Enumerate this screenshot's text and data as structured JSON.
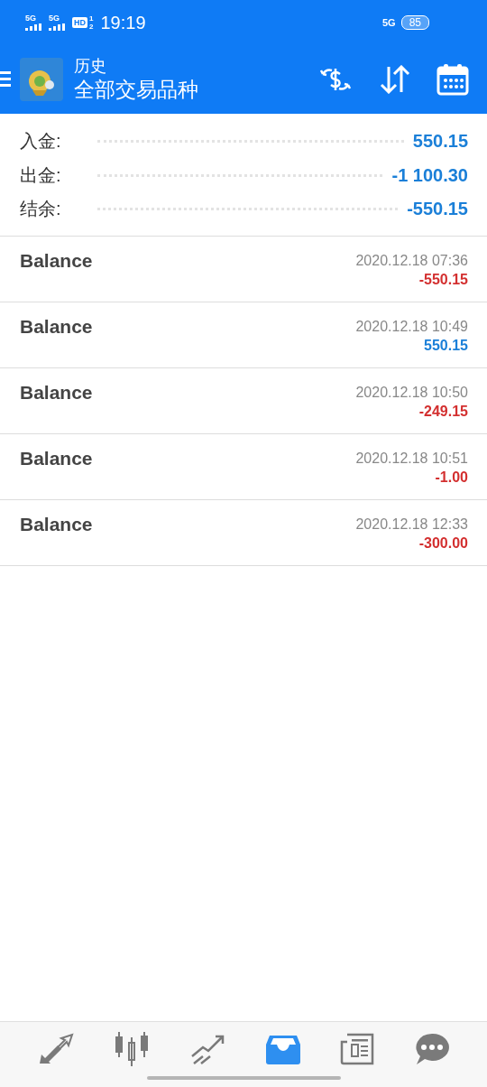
{
  "status_bar": {
    "sim_1": "5G",
    "sim_2": "5G",
    "hd": "HD",
    "hd_sub_1": "1",
    "hd_sub_2": "2",
    "time": "19:19",
    "network": "5G",
    "battery": "85"
  },
  "header": {
    "title": "历史",
    "subtitle": "全部交易品种"
  },
  "summary": [
    {
      "label": "入金:",
      "value": "550.15"
    },
    {
      "label": "出金:",
      "value": "-1 100.30"
    },
    {
      "label": "结余:",
      "value": "-550.15"
    }
  ],
  "deals": [
    {
      "name": "Balance",
      "time": "2020.12.18 07:36",
      "amount": "-550.15",
      "color": "#d32f2f"
    },
    {
      "name": "Balance",
      "time": "2020.12.18 10:49",
      "amount": "550.15",
      "color": "#1a7fd8"
    },
    {
      "name": "Balance",
      "time": "2020.12.18 10:50",
      "amount": "-249.15",
      "color": "#d32f2f"
    },
    {
      "name": "Balance",
      "time": "2020.12.18 10:51",
      "amount": "-1.00",
      "color": "#d32f2f"
    },
    {
      "name": "Balance",
      "time": "2020.12.18 12:33",
      "amount": "-300.00",
      "color": "#d32f2f"
    }
  ],
  "bottom_nav": [
    {
      "kind": "trade",
      "selected": false
    },
    {
      "kind": "chart",
      "selected": false
    },
    {
      "kind": "trend",
      "selected": false
    },
    {
      "kind": "history",
      "selected": true
    },
    {
      "kind": "news",
      "selected": false
    },
    {
      "kind": "chat",
      "selected": false
    }
  ]
}
